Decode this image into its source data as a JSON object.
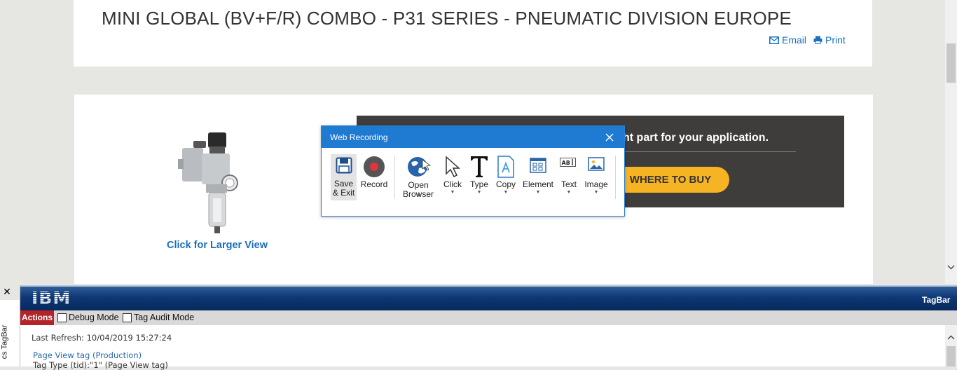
{
  "header": {
    "product_title": "MINI GLOBAL (BV+F/R) COMBO - P31 SERIES - PNEUMATIC DIVISION EUROPE",
    "email_label": "Email",
    "print_label": "Print"
  },
  "product": {
    "larger_view_label": "Click for Larger View"
  },
  "promo": {
    "text": "ht part for your application.",
    "buy_label": "WHERE TO BUY",
    "buy_color": "#f6b323",
    "banner_color": "#3e3d3b"
  },
  "recorder": {
    "title": "Web Recording",
    "close_icon": "close-icon",
    "tools": [
      {
        "label": "Save\n& Exit",
        "icon": "save-icon"
      },
      {
        "label": "Record",
        "icon": "record-icon"
      },
      {
        "label": "Open\nBrowser",
        "icon": "globe-cursor-icon"
      },
      {
        "label": "Click",
        "icon": "pointer-icon"
      },
      {
        "label": "Type",
        "icon": "type-t-icon"
      },
      {
        "label": "Copy",
        "icon": "copy-document-icon"
      },
      {
        "label": "Element",
        "icon": "element-grid-icon"
      },
      {
        "label": "Text",
        "icon": "text-box-icon"
      },
      {
        "label": "Image",
        "icon": "image-icon"
      }
    ],
    "accent_color": "#1f7ad2"
  },
  "tagbar": {
    "logo": "IBM",
    "name": "TagBar",
    "side_label": "cs TagBar",
    "actions_label": "Actions",
    "debug_mode_label": "Debug Mode",
    "tag_audit_mode_label": "Tag Audit Mode",
    "last_refresh": "Last Refresh: 10/04/2019 15:27:24",
    "page_view_tag": "Page View tag (Production)",
    "tag_type_line": "Tag Type (tid):\"1\" (Page View tag)"
  }
}
